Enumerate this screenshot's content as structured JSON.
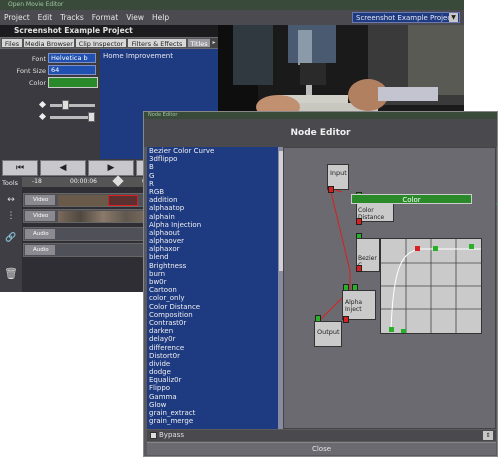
{
  "main_window": {
    "title": "Open Movie Editor",
    "menus": [
      "Project",
      "Edit",
      "Tracks",
      "Format",
      "View",
      "Help"
    ],
    "project_selector": "Screenshot Example Project",
    "project_title": "Screenshot Example Project",
    "tabs": [
      "Files",
      "Media Browser",
      "Clip Inspector",
      "Filters & Effects",
      "Titles"
    ],
    "active_tab": "Titles",
    "properties": {
      "font_label": "Font",
      "font_value": "Helvetica b",
      "font_size_label": "Font Size",
      "font_size_value": "64",
      "color_label": "Color",
      "color_value": "#2a8a2a"
    },
    "title_text": "Home Improvement",
    "timeline": {
      "tools_label": "Tools",
      "time_start": "-18",
      "time_mid": "00:00:06",
      "time_end": "00",
      "tracks": [
        {
          "type": "Video",
          "label": "Video"
        },
        {
          "type": "Video",
          "label": "Video"
        },
        {
          "type": "Audio",
          "label": "Audio"
        },
        {
          "type": "Audio",
          "label": "Audio"
        }
      ]
    }
  },
  "node_editor": {
    "window_title": "Node Editor",
    "title": "Node Editor",
    "filter_list": [
      "Bezier Color Curve",
      "3dflippo",
      "B",
      "G",
      "R",
      "RGB",
      "addition",
      "alphaatop",
      "alphain",
      "Alpha Injection",
      "alphaout",
      "alphaover",
      "alphaxor",
      "blend",
      "Brightness",
      "burn",
      "bw0r",
      "Cartoon",
      "color_only",
      "Color Distance",
      "Composition",
      "Contrast0r",
      "darken",
      "delay0r",
      "difference",
      "Distort0r",
      "divide",
      "dodge",
      "Equaliz0r",
      "Flippo",
      "Gamma",
      "Glow",
      "grain_extract",
      "grain_merge"
    ],
    "nodes": {
      "input": "Input",
      "color_distance": "Color Distance",
      "bezier": "Bezier C",
      "alpha_injection": "Alpha Inject",
      "output": "Output"
    },
    "color_node_label": "Color",
    "color_node_color": "#2a8a2a",
    "bypass_label": "Bypass",
    "close_label": "Close"
  },
  "colors": {
    "accent_blue": "#1e3a80",
    "port_red": "#d82020",
    "port_green": "#28b028"
  }
}
